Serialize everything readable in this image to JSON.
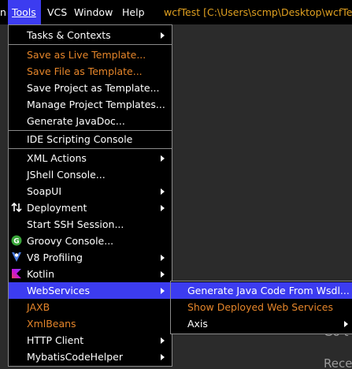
{
  "menubar": {
    "partial_item": "n",
    "items": [
      {
        "label": "Tools"
      },
      {
        "label": "VCS"
      },
      {
        "label": "Window"
      },
      {
        "label": "Help"
      }
    ],
    "window_title": "wcfTest [C:\\Users\\scmp\\Desktop\\wcfTest]"
  },
  "tools_menu": {
    "items": [
      {
        "label": "Tasks & Contexts"
      },
      {
        "label": "Save as Live Template..."
      },
      {
        "label": "Save File as Template..."
      },
      {
        "label": "Save Project as Template..."
      },
      {
        "label": "Manage Project Templates..."
      },
      {
        "label": "Generate JavaDoc..."
      },
      {
        "label": "IDE Scripting Console"
      },
      {
        "label": "XML Actions"
      },
      {
        "label": "JShell Console..."
      },
      {
        "label": "SoapUI"
      },
      {
        "label": "Deployment"
      },
      {
        "label": "Start SSH Session..."
      },
      {
        "label": "Groovy Console..."
      },
      {
        "label": "V8 Profiling"
      },
      {
        "label": "Kotlin"
      },
      {
        "label": "WebServices"
      },
      {
        "label": "JAXB"
      },
      {
        "label": "XmlBeans"
      },
      {
        "label": "HTTP Client"
      },
      {
        "label": "MybatisCodeHelper"
      }
    ]
  },
  "webservices_menu": {
    "items": [
      {
        "label": "Generate Java Code From Wsdl..."
      },
      {
        "label": "Show Deployed Web Services"
      },
      {
        "label": "Axis"
      }
    ]
  },
  "background": {
    "text1": "Go t",
    "text2": "Rece"
  },
  "colors": {
    "highlight": "#3c3cf0",
    "disabled_orange": "#e5852a",
    "title_orange": "#e0a020",
    "menu_bg": "#000000",
    "editor_bg": "#2b2b2b",
    "groovy_icon": "#3aa53a",
    "v8_icon": "#4a7be0"
  }
}
